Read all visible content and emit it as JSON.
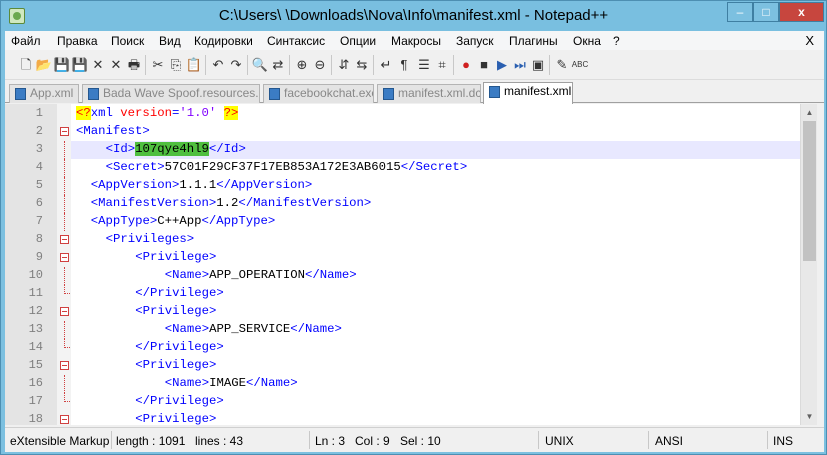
{
  "window": {
    "title": "C:\\Users\\      \\Downloads\\Nova\\Info\\manifest.xml - Notepad++",
    "min_label": "‒",
    "max_label": "□",
    "close_label": "x"
  },
  "menu": {
    "items": [
      "Файл",
      "Правка",
      "Поиск",
      "Вид",
      "Кодировки",
      "Синтаксис",
      "Опции",
      "Макросы",
      "Запуск",
      "Плагины",
      "Окна",
      "?"
    ],
    "close_label": "X"
  },
  "toolbar": {
    "icons": [
      "new-file-icon",
      "open-file-icon",
      "save-icon",
      "save-all-icon",
      "close-file-icon",
      "close-all-icon",
      "print-icon",
      "cut-icon",
      "copy-icon",
      "paste-icon",
      "undo-icon",
      "redo-icon",
      "find-icon",
      "replace-icon",
      "zoom-in-icon",
      "zoom-out-icon",
      "sync-vertical-icon",
      "sync-horizontal-icon",
      "word-wrap-icon",
      "show-all-chars-icon",
      "indent-guide-icon",
      "user-language-icon",
      "record-macro-icon",
      "stop-macro-icon",
      "play-macro-icon",
      "run-macro-multiple-icon",
      "save-macro-icon",
      "spellcheck-icon",
      "abc-spellcheck-icon"
    ],
    "glyphs": [
      "🗋",
      "📂",
      "💾",
      "💾",
      "✕",
      "✕",
      "🖶",
      "✂",
      "⎘",
      "📋",
      "↶",
      "↷",
      "🔍",
      "⇄",
      "⊕",
      "⊖",
      "⇵",
      "⇆",
      "↵",
      "¶",
      "☰",
      "⌗",
      "●",
      "■",
      "▶",
      "⏭",
      "▣",
      "✎",
      "ABC"
    ]
  },
  "tabs": [
    {
      "label": "App.xml",
      "active": false
    },
    {
      "label": "Bada Wave Spoof.resources.dll",
      "active": false
    },
    {
      "label": "facebookchat.exe",
      "active": false
    },
    {
      "label": "manifest.xml.dcf",
      "active": false
    },
    {
      "label": "manifest.xml",
      "active": true
    }
  ],
  "editor": {
    "lines": [
      {
        "n": "1",
        "segs": [
          [
            "pi",
            "<?"
          ],
          [
            "tag",
            "xml "
          ],
          [
            "attr",
            "version"
          ],
          [
            "tag",
            "="
          ],
          [
            "val",
            "'1.0'"
          ],
          [
            "tag",
            " "
          ],
          [
            "pi",
            "?>"
          ]
        ],
        "indent": 0,
        "fold": "none"
      },
      {
        "n": "2",
        "segs": [
          [
            "tag",
            "<Manifest>"
          ]
        ],
        "indent": 0,
        "fold": "open"
      },
      {
        "n": "3",
        "segs": [
          [
            "tag",
            "<Id>"
          ],
          [
            "sel",
            "107qye4hl9"
          ],
          [
            "tag",
            "</Id>"
          ]
        ],
        "indent": 4,
        "fold": "line",
        "current": true
      },
      {
        "n": "4",
        "segs": [
          [
            "tag",
            "<Secret>"
          ],
          [
            "text",
            "57C01F29CF37F17EB853A172E3AB6015"
          ],
          [
            "tag",
            "</Secret>"
          ]
        ],
        "indent": 4,
        "fold": "line"
      },
      {
        "n": "5",
        "segs": [
          [
            "tag",
            "<AppVersion>"
          ],
          [
            "text",
            "1.1.1"
          ],
          [
            "tag",
            "</AppVersion>"
          ]
        ],
        "indent": 2,
        "fold": "line"
      },
      {
        "n": "6",
        "segs": [
          [
            "tag",
            "<ManifestVersion>"
          ],
          [
            "text",
            "1.2"
          ],
          [
            "tag",
            "</ManifestVersion>"
          ]
        ],
        "indent": 2,
        "fold": "line"
      },
      {
        "n": "7",
        "segs": [
          [
            "tag",
            "<AppType>"
          ],
          [
            "text",
            "C++App"
          ],
          [
            "tag",
            "</AppType>"
          ]
        ],
        "indent": 2,
        "fold": "line"
      },
      {
        "n": "8",
        "segs": [
          [
            "tag",
            "<Privileges>"
          ]
        ],
        "indent": 4,
        "fold": "open"
      },
      {
        "n": "9",
        "segs": [
          [
            "tag",
            "<Privilege>"
          ]
        ],
        "indent": 8,
        "fold": "open"
      },
      {
        "n": "10",
        "segs": [
          [
            "tag",
            "<Name>"
          ],
          [
            "text",
            "APP_OPERATION"
          ],
          [
            "tag",
            "</Name>"
          ]
        ],
        "indent": 12,
        "fold": "line"
      },
      {
        "n": "11",
        "segs": [
          [
            "tag",
            "</Privilege>"
          ]
        ],
        "indent": 8,
        "fold": "end"
      },
      {
        "n": "12",
        "segs": [
          [
            "tag",
            "<Privilege>"
          ]
        ],
        "indent": 8,
        "fold": "open"
      },
      {
        "n": "13",
        "segs": [
          [
            "tag",
            "<Name>"
          ],
          [
            "text",
            "APP_SERVICE"
          ],
          [
            "tag",
            "</Name>"
          ]
        ],
        "indent": 12,
        "fold": "line"
      },
      {
        "n": "14",
        "segs": [
          [
            "tag",
            "</Privilege>"
          ]
        ],
        "indent": 8,
        "fold": "end"
      },
      {
        "n": "15",
        "segs": [
          [
            "tag",
            "<Privilege>"
          ]
        ],
        "indent": 8,
        "fold": "open"
      },
      {
        "n": "16",
        "segs": [
          [
            "tag",
            "<Name>"
          ],
          [
            "text",
            "IMAGE"
          ],
          [
            "tag",
            "</Name>"
          ]
        ],
        "indent": 12,
        "fold": "line"
      },
      {
        "n": "17",
        "segs": [
          [
            "tag",
            "</Privilege>"
          ]
        ],
        "indent": 8,
        "fold": "end"
      },
      {
        "n": "18",
        "segs": [
          [
            "tag",
            "<Privilege>"
          ]
        ],
        "indent": 8,
        "fold": "open"
      }
    ]
  },
  "status": {
    "language": "eXtensible Markup",
    "length": "length : 1091",
    "lines": "lines : 43",
    "ln": "Ln : 3",
    "col": "Col : 9",
    "sel": "Sel : 10",
    "eol": "UNIX",
    "encoding": "ANSI",
    "mode": "INS"
  },
  "colors": {
    "tag": "#0000ff",
    "attribute": "#ff0000",
    "value": "#8000ff",
    "selection": "#4fbf3f",
    "current_line": "#e8e8ff",
    "close_button": "#c7463e"
  }
}
